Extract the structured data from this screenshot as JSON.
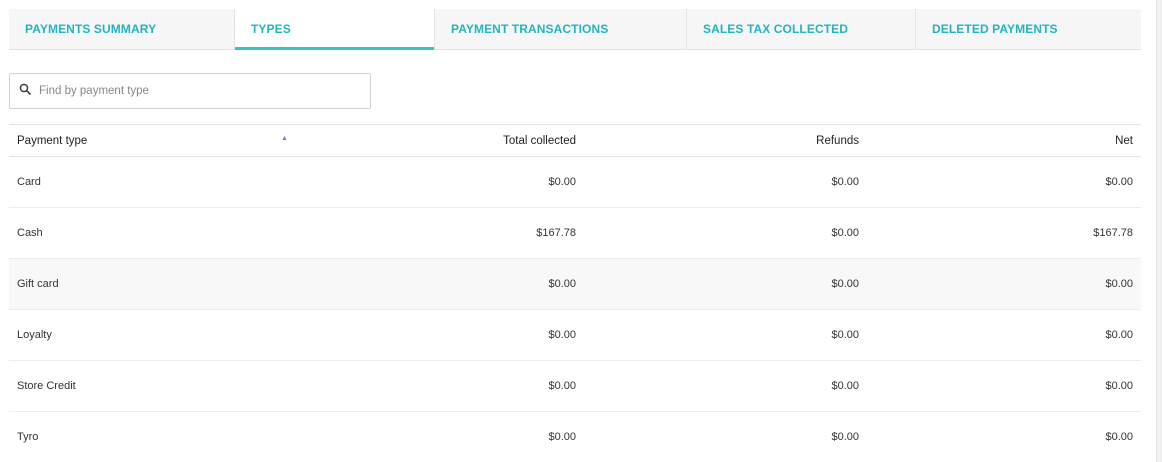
{
  "tabs": [
    {
      "label": "PAYMENTS SUMMARY"
    },
    {
      "label": "TYPES"
    },
    {
      "label": "PAYMENT TRANSACTIONS"
    },
    {
      "label": "SALES TAX COLLECTED"
    },
    {
      "label": "DELETED PAYMENTS"
    }
  ],
  "active_tab": "TYPES",
  "search": {
    "placeholder": "Find by payment type",
    "value": ""
  },
  "table": {
    "headers": {
      "payment_type": "Payment type",
      "total_collected": "Total collected",
      "refunds": "Refunds",
      "net": "Net"
    },
    "sort": {
      "column": "Payment type",
      "direction": "ascending"
    },
    "rows": [
      {
        "payment_type": "Card",
        "total_collected": "$0.00",
        "refunds": "$0.00",
        "net": "$0.00"
      },
      {
        "payment_type": "Cash",
        "total_collected": "$167.78",
        "refunds": "$0.00",
        "net": "$167.78"
      },
      {
        "payment_type": "Gift card",
        "total_collected": "$0.00",
        "refunds": "$0.00",
        "net": "$0.00"
      },
      {
        "payment_type": "Loyalty",
        "total_collected": "$0.00",
        "refunds": "$0.00",
        "net": "$0.00"
      },
      {
        "payment_type": "Store Credit",
        "total_collected": "$0.00",
        "refunds": "$0.00",
        "net": "$0.00"
      },
      {
        "payment_type": "Tyro",
        "total_collected": "$0.00",
        "refunds": "$0.00",
        "net": "$0.00"
      }
    ]
  },
  "colors": {
    "accent": "#22b5c1",
    "active_underline": "#3dbfc7",
    "sort_arrow": "#6a86d6"
  },
  "icons": {
    "search": "search-icon",
    "sort": "sort-ascending-icon"
  }
}
